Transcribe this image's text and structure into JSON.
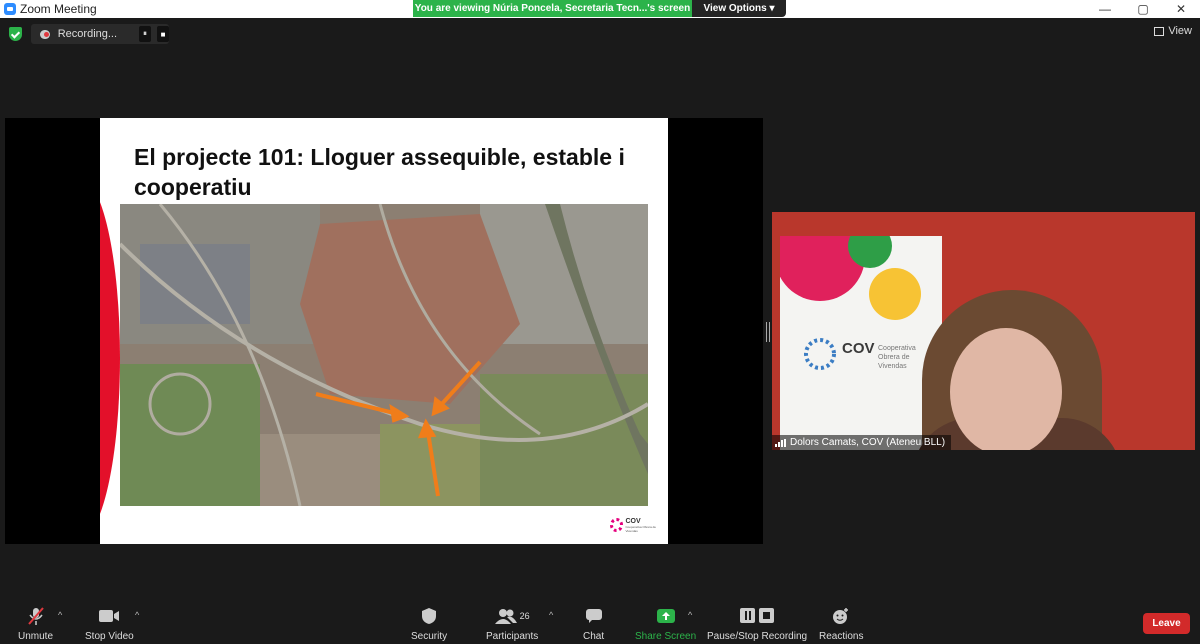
{
  "window": {
    "title": "Zoom Meeting",
    "minimize": "—",
    "restore": "▢",
    "close": "✕"
  },
  "share_banner": {
    "message": "You are viewing Núria Poncela, Secretaria Tecn...'s screen",
    "options_label": "View Options ▾"
  },
  "recording": {
    "status": "Recording...",
    "pause_icon": "⏸",
    "stop_icon": "■"
  },
  "view_button": {
    "label": "View",
    "icon": "grid-icon"
  },
  "slide": {
    "title": "El projecte 101: Lloguer assequible, estable i cooperatiu",
    "logo_text": "COV",
    "logo_subtext": "Cooperativa Obrera de Vivendas"
  },
  "video": {
    "banner_logo": "COV",
    "banner_subtext": "Cooperativa Obrera de Vivendas",
    "participant_name": "Dolors Camats, COV (Ateneu BLL)"
  },
  "toolbar": {
    "unmute": "Unmute",
    "stop_video": "Stop Video",
    "security": "Security",
    "participants": "Participants",
    "participants_count": "26",
    "chat": "Chat",
    "share_screen": "Share Screen",
    "pause_stop_recording": "Pause/Stop Recording",
    "reactions": "Reactions",
    "leave": "Leave"
  },
  "colors": {
    "share_green": "#2cb34a",
    "leave_red": "#d22a2a",
    "slide_red": "#e3102a",
    "arrow_orange": "#f07d1a"
  }
}
